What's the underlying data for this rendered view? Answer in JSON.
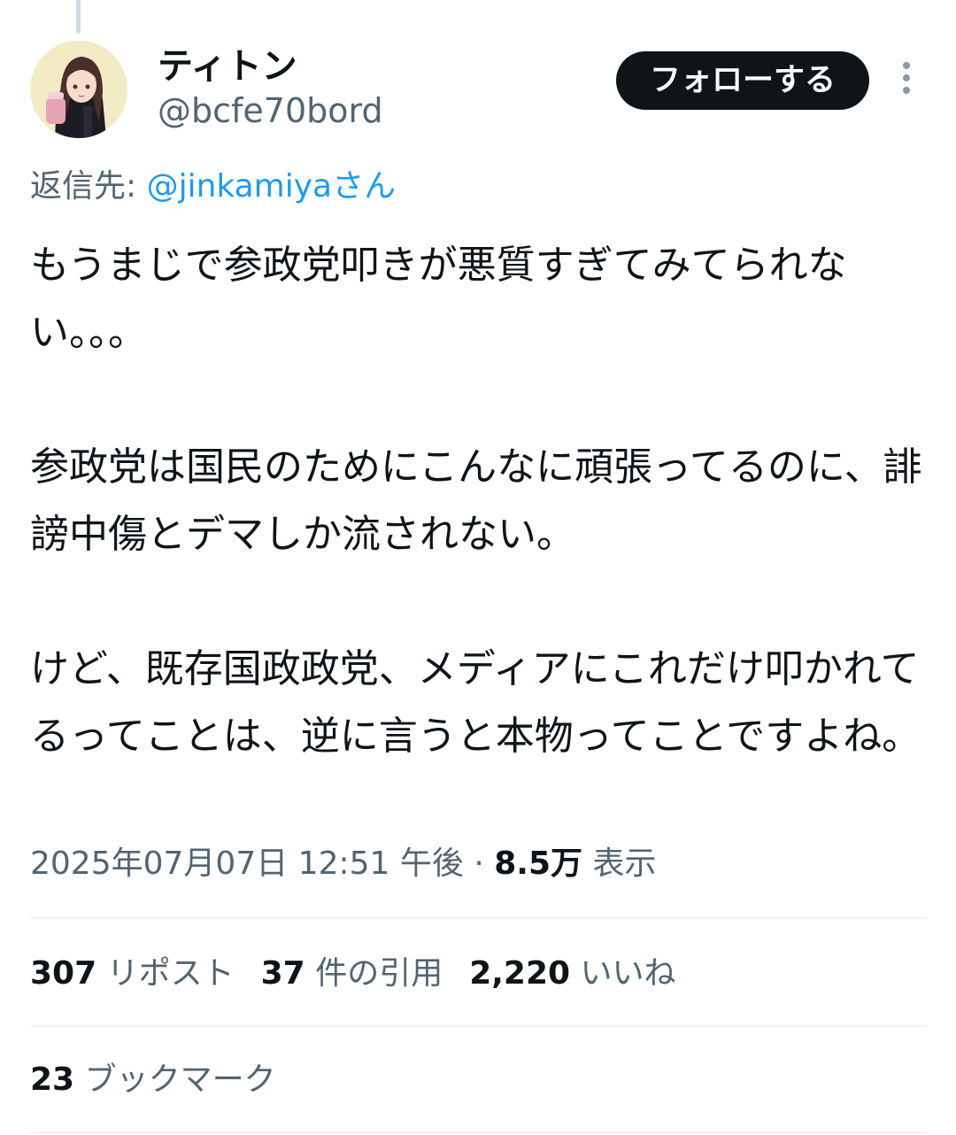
{
  "user": {
    "display_name": "ティトン",
    "handle": "@bcfe70bord",
    "avatar": "avatar-illustration"
  },
  "follow_button": {
    "label": "フォローする"
  },
  "more_icon": "more-vertical-icon",
  "reply_to": {
    "prefix": "返信先: ",
    "mention": "@jinkamiyaさん"
  },
  "tweet": {
    "text": "もうまじで参政党叩きが悪質すぎてみてられない。。。\n\n参政党は国民のためにこんなに頑張ってるのに、誹謗中傷とデマしか流されない。\n\nけど、既存国政政党、メディアにこれだけ叩かれてるってことは、逆に言うと本物ってことですよね。"
  },
  "meta": {
    "timestamp": "2025年07月07日 12:51 午後",
    "separator": " · ",
    "views_count": "8.5万",
    "views_label": "表示"
  },
  "stats": {
    "reposts": {
      "count": "307",
      "label": "リポスト"
    },
    "quotes": {
      "count": "37",
      "label": "件の引用"
    },
    "likes": {
      "count": "2,220",
      "label": "いいね"
    },
    "bookmarks": {
      "count": "23",
      "label": "ブックマーク"
    }
  },
  "colors": {
    "text_primary": "#0f1419",
    "text_secondary": "#536471",
    "link": "#1d9bf0",
    "follow_button_bg": "#0f1419",
    "divider": "#eff3f4"
  }
}
